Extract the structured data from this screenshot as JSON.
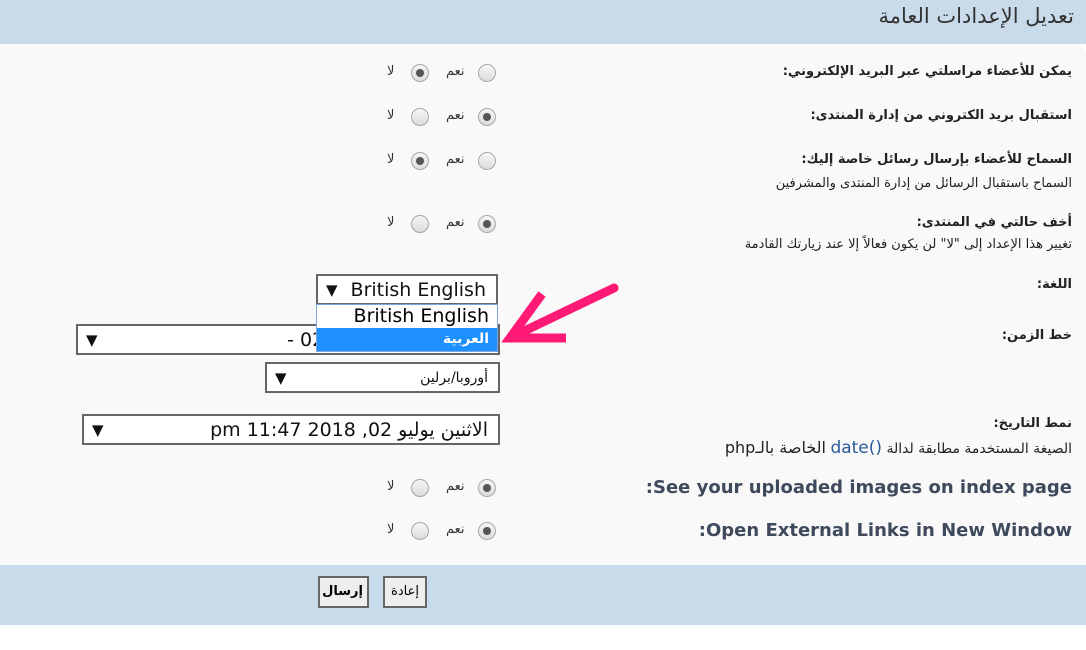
{
  "header": {
    "title": "تعديل الإعدادات العامة"
  },
  "radio_labels": {
    "yes": "نعم",
    "no": "لا"
  },
  "settings": [
    {
      "label": "يمكن للأعضاء مراسلتي عبر البريد الإلكتروني:",
      "selected": "no"
    },
    {
      "label": "استقبال بريد الكتروني من إدارة المنتدى:",
      "selected": "yes"
    },
    {
      "label": "السماح للأعضاء بإرسال رسائل خاصة إليك:",
      "description": "السماح باستقبال الرسائل من إدارة المنتدى والمشرفين",
      "selected": "no"
    },
    {
      "label": "أخف حالتي في المنتدى:",
      "description": "تغيير هذا الإعداد إلى \"لا\" لن يكون فعالاً إلا عند زيارتك القادمة",
      "selected": "yes"
    },
    {
      "label": "See your uploaded images on index page:",
      "selected": "yes"
    },
    {
      "label": "Open External Links in New Window:",
      "selected": "yes"
    }
  ],
  "language": {
    "label": "اللغة:",
    "value": "British English",
    "options": [
      "British English",
      "العربية"
    ],
    "highlighted": "العربية"
  },
  "timezone": {
    "label": "خط الزمن:",
    "value": "23:47 ،2018 يوليو 02 -",
    "region": "أوروبا/برلين"
  },
  "date_format": {
    "label": "نمط التاريخ:",
    "value": "الاثنين يوليو 02, 2018 11:47 pm",
    "desc_prefix": "الصيغة المستخدمة مطابقة لدالة",
    "desc_code": "date()",
    "desc_suffix": "الخاصة بالـphp"
  },
  "buttons": {
    "submit": "إرسال",
    "reset": "إعادة"
  },
  "annotation": {
    "arrow_color": "#ff1a75"
  }
}
